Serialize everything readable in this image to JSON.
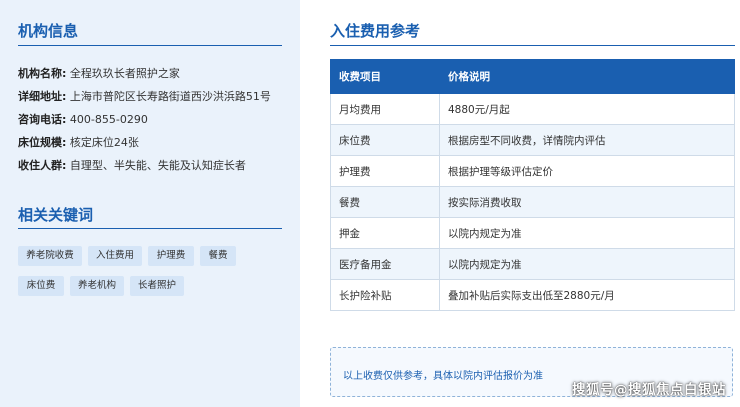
{
  "institution": {
    "title": "机构信息",
    "rows": [
      {
        "label": "机构名称:",
        "value": "全程玖玖长者照护之家"
      },
      {
        "label": "详细地址:",
        "value": "上海市普陀区长寿路街道西沙洪浜路51号"
      },
      {
        "label": "咨询电话:",
        "value": "400-855-0290"
      },
      {
        "label": "床位规模:",
        "value": "核定床位24张"
      },
      {
        "label": "收住人群:",
        "value": "自理型、半失能、失能及认知症长者"
      }
    ]
  },
  "keywords": {
    "title": "相关关键词",
    "tags": [
      "养老院收费",
      "入住费用",
      "护理费",
      "餐费",
      "床位费",
      "养老机构",
      "长者照护"
    ]
  },
  "fees": {
    "title": "入住费用参考",
    "headers": [
      "收费项目",
      "价格说明"
    ],
    "rows": [
      {
        "item": "月均费用",
        "desc": "4880元/月起"
      },
      {
        "item": "床位费",
        "desc": "根据房型不同收费，详情院内评估"
      },
      {
        "item": "护理费",
        "desc": "根据护理等级评估定价"
      },
      {
        "item": "餐费",
        "desc": "按实际消费收取"
      },
      {
        "item": "押金",
        "desc": "以院内规定为准"
      },
      {
        "item": "医疗备用金",
        "desc": "以院内规定为准"
      },
      {
        "item": "长护险补贴",
        "desc": "叠加补贴后实际支出低至2880元/月"
      }
    ],
    "note": "以上收费仅供参考，具体以院内评估报价为准"
  },
  "watermark": "搜狐号@搜狐焦点白银站",
  "colors": {
    "accent": "#1a5fb0",
    "left_bg": "#eaf2fb",
    "tag_bg": "#d5e5f7"
  }
}
